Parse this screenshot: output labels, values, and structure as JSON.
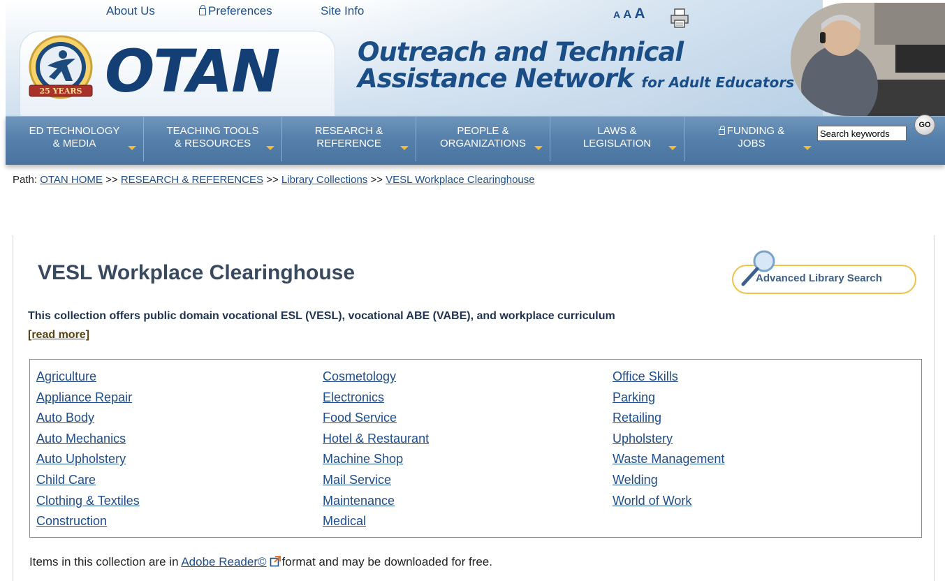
{
  "header": {
    "top_links": [
      {
        "label": "About Us"
      },
      {
        "label": "Preferences",
        "icon": "lock-icon"
      },
      {
        "label": "Site Info"
      }
    ],
    "font_sizes": [
      "A",
      "A",
      "A"
    ],
    "print_icon": "printer-icon",
    "logo": {
      "wordmark": "OTAN",
      "seal_text": "25 YEARS"
    },
    "tagline": {
      "line1": "Outreach and Technical",
      "line2": "Assistance Network",
      "line2_suffix": "for Adult Educators"
    }
  },
  "nav": {
    "items": [
      {
        "line1": "ED TECHNOLOGY",
        "line2": "& MEDIA"
      },
      {
        "line1": "TEACHING TOOLS",
        "line2": "& RESOURCES"
      },
      {
        "line1": "RESEARCH &",
        "line2": "REFERENCE"
      },
      {
        "line1": "PEOPLE &",
        "line2": "ORGANIZATIONS"
      },
      {
        "line1": "LAWS &",
        "line2": "LEGISLATION"
      },
      {
        "line1": "FUNDING &",
        "line2": "JOBS",
        "icon": "lock-icon"
      }
    ],
    "search": {
      "value": "Search keywords",
      "go_label": "GO"
    }
  },
  "breadcrumb": {
    "prefix": "Path:",
    "separator": ">>",
    "items": [
      "OTAN HOME",
      "RESEARCH & REFERENCES",
      "Library Collections",
      "VESL Workplace Clearinghouse"
    ]
  },
  "main": {
    "title": "VESL Workplace Clearinghouse",
    "advanced_search_label": "Advanced Library Search",
    "description": "This collection offers public domain vocational ESL (VESL), vocational ABE (VABE), and workplace curriculum",
    "read_more": "[read more]",
    "topics": {
      "col1": [
        "Agriculture",
        "Appliance Repair",
        "Auto Body",
        "Auto Mechanics",
        "Auto Upholstery",
        "Child Care",
        "Clothing & Textiles",
        "Construction"
      ],
      "col2": [
        "Cosmetology",
        "Electronics",
        "Food Service",
        "Hotel & Restaurant",
        "Machine Shop",
        "Mail Service",
        "Maintenance",
        "Medical"
      ],
      "col3": [
        "Office Skills",
        "Parking",
        "Retailing",
        "Upholstery",
        "Waste Management",
        "Welding",
        "World of Work"
      ]
    },
    "footer_note": {
      "before": "Items in this collection are in",
      "link": "Adobe Reader©",
      "after": "format and may be downloaded for free."
    }
  },
  "colors": {
    "brand_blue": "#143f74",
    "nav_blue": "#5580ab",
    "link": "#1f4e8c",
    "accent_gold": "#f0c24a"
  }
}
